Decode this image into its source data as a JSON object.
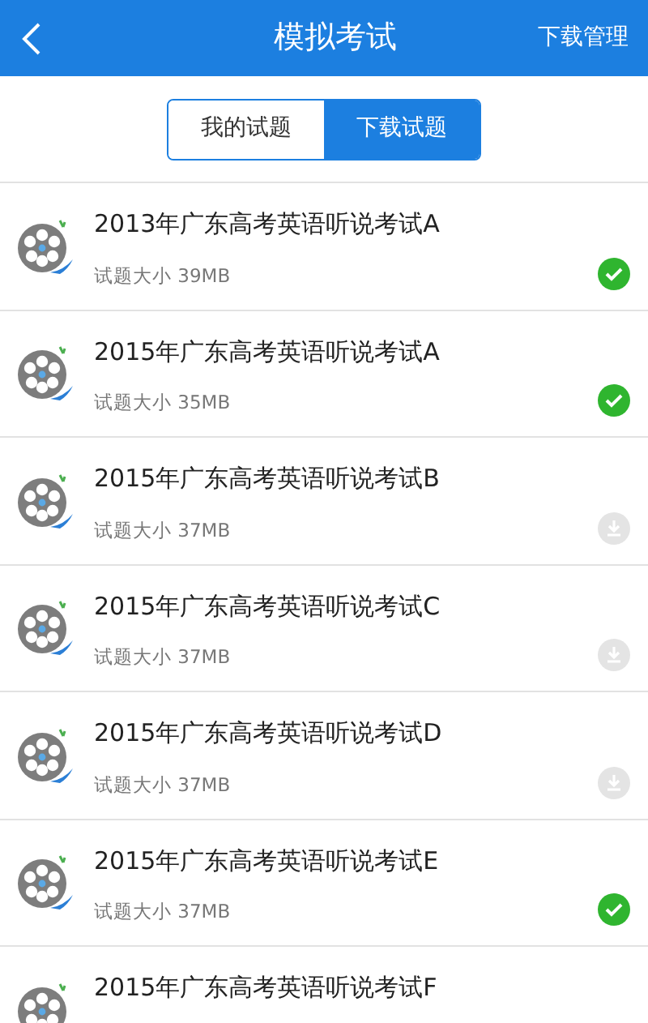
{
  "header": {
    "title": "模拟考试",
    "action": "下载管理"
  },
  "tabs": [
    {
      "label": "我的试题",
      "selected": false
    },
    {
      "label": "下载试题",
      "selected": true
    }
  ],
  "exams": [
    {
      "title": "2013年广东高考英语听说考试A",
      "size": "试题大小 39MB",
      "downloaded": true
    },
    {
      "title": "2015年广东高考英语听说考试A",
      "size": "试题大小 35MB",
      "downloaded": true
    },
    {
      "title": "2015年广东高考英语听说考试B",
      "size": "试题大小 37MB",
      "downloaded": false
    },
    {
      "title": "2015年广东高考英语听说考试C",
      "size": "试题大小 37MB",
      "downloaded": false
    },
    {
      "title": "2015年广东高考英语听说考试D",
      "size": "试题大小 37MB",
      "downloaded": false
    },
    {
      "title": "2015年广东高考英语听说考试E",
      "size": "试题大小 37MB",
      "downloaded": true
    },
    {
      "title": "2015年广东高考英语听说考试F"
    }
  ]
}
